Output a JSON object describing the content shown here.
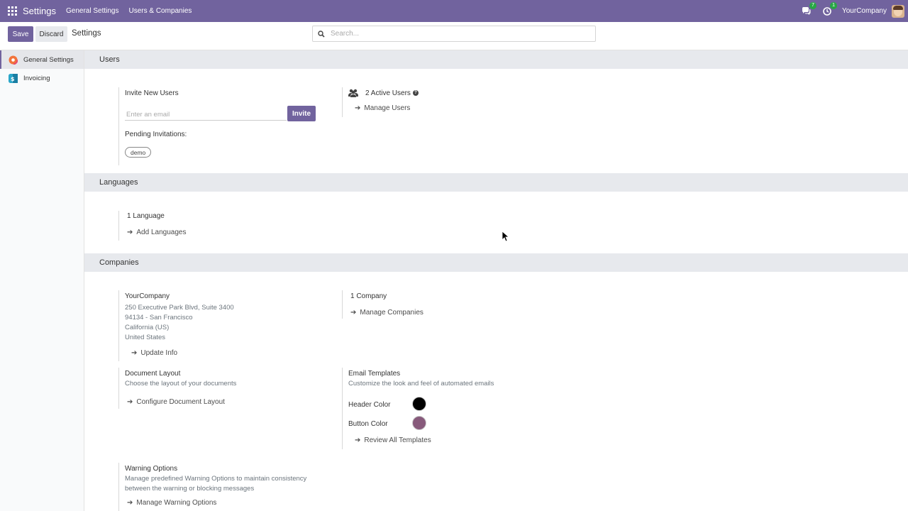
{
  "navbar": {
    "brand": "Settings",
    "menus": [
      "General Settings",
      "Users & Companies"
    ],
    "chat_badge": "7",
    "activity_badge": "1",
    "company": "YourCompany"
  },
  "control": {
    "save_label": "Save",
    "discard_label": "Discard",
    "breadcrumb": "Settings",
    "search_placeholder": "Search..."
  },
  "sidebar": {
    "items": [
      {
        "label": "General Settings",
        "active": true
      },
      {
        "label": "Invoicing",
        "active": false
      }
    ]
  },
  "users": {
    "header": "Users",
    "invite_title": "Invite New Users",
    "email_placeholder": "Enter an email",
    "invite_label": "Invite",
    "pending_label": "Pending Invitations:",
    "pending": [
      "demo"
    ],
    "active_users": "2 Active Users",
    "manage_users": "Manage Users"
  },
  "languages": {
    "header": "Languages",
    "count": "1 Language",
    "add": "Add Languages"
  },
  "companies": {
    "header": "Companies",
    "company_name": "YourCompany",
    "address": [
      "250 Executive Park Blvd, Suite 3400",
      "94134 - San Francisco",
      "California (US)",
      "United States"
    ],
    "update_info": "Update Info",
    "company_count": "1 Company",
    "manage_companies": "Manage Companies",
    "doc_layout_title": "Document Layout",
    "doc_layout_desc": "Choose the layout of your documents",
    "configure_layout": "Configure Document Layout",
    "email_templates_title": "Email Templates",
    "email_templates_desc": "Customize the look and feel of automated emails",
    "header_color_label": "Header Color",
    "header_color": "#000000",
    "button_color_label": "Button Color",
    "button_color": "#875a7b",
    "review_templates": "Review All Templates",
    "warning_title": "Warning Options",
    "warning_desc": [
      "Manage predefined Warning Options to maintain consistency",
      "between the warning or blocking messages"
    ],
    "manage_warning": "Manage Warning Options"
  },
  "colors": {
    "brand": "#71639e",
    "section_bg": "#e7e9ed"
  }
}
